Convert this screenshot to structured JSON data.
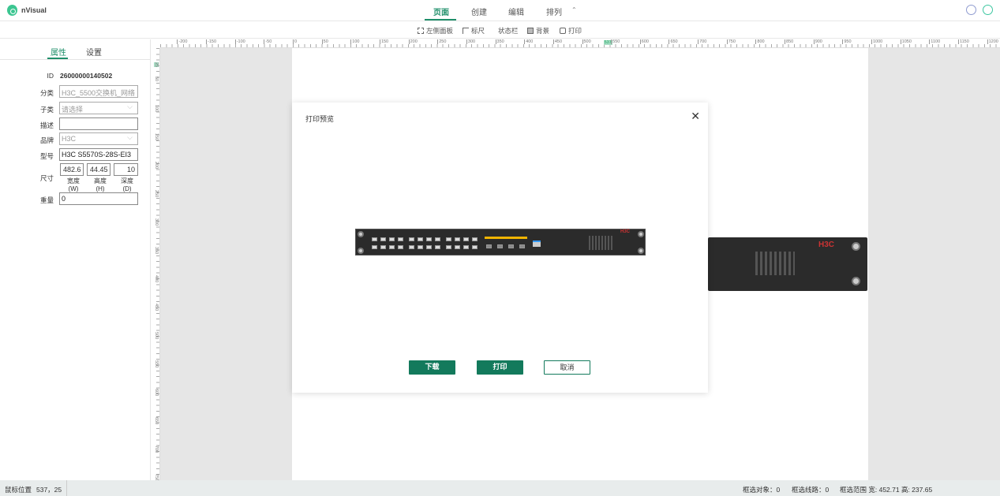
{
  "app": {
    "name": "nVisual"
  },
  "menu_tabs": [
    {
      "label": "页面",
      "active": true
    },
    {
      "label": "创建"
    },
    {
      "label": "编辑"
    },
    {
      "label": "排列"
    }
  ],
  "toolbar": {
    "left_panel": "左侧面板",
    "ruler": "标尺",
    "status_bar": "状态栏",
    "background": "背景",
    "print": "打印"
  },
  "left_panel": {
    "tabs": [
      {
        "label": "属性",
        "active": true
      },
      {
        "label": "设置"
      }
    ],
    "fields": {
      "id_label": "ID",
      "id_value": "26000000140502",
      "category_label": "分类",
      "category_value": "H3C_5500交换机_网络",
      "subcategory_label": "子类",
      "subcategory_placeholder": "请选择",
      "description_label": "描述",
      "description_value": "",
      "brand_label": "品牌",
      "brand_value": "H3C",
      "model_label": "型号",
      "model_value": "H3C S5570S-28S-EI3",
      "size_label": "尺寸",
      "width": "482.6",
      "height": "44.45",
      "depth": "10",
      "width_label": "宽度",
      "width_unit": "(W)",
      "height_label": "高度",
      "height_unit": "(H)",
      "depth_label": "深度",
      "depth_unit": "(D)",
      "weight_label": "重量",
      "weight_value": "0"
    }
  },
  "rulers": {
    "h_labels": [
      "-200",
      "-150",
      "-100",
      "-50",
      "0",
      "50",
      "100",
      "150",
      "200",
      "250",
      "300",
      "350",
      "400",
      "450",
      "500",
      "537",
      "550",
      "600",
      "650",
      "700",
      "750",
      "800",
      "850",
      "900",
      "950",
      "1000",
      "1050",
      "1100",
      "1150",
      "1200"
    ],
    "v_labels": [
      "25",
      "50",
      "100",
      "150",
      "200",
      "250",
      "300",
      "350",
      "400",
      "450",
      "500",
      "550",
      "600",
      "650",
      "700",
      "750"
    ]
  },
  "modal": {
    "title": "打印预览",
    "download": "下载",
    "print": "打印",
    "cancel": "取消"
  },
  "status": {
    "mouse_label": "鼠标位置",
    "mouse_value": "537，25",
    "sel_objects": "框选对象：0",
    "sel_links": "框选线路：0",
    "sel_range": "框选范围 宽: 452.71 高: 237.65"
  },
  "colors": {
    "accent": "#1f8f6a",
    "button": "#137a5c"
  }
}
